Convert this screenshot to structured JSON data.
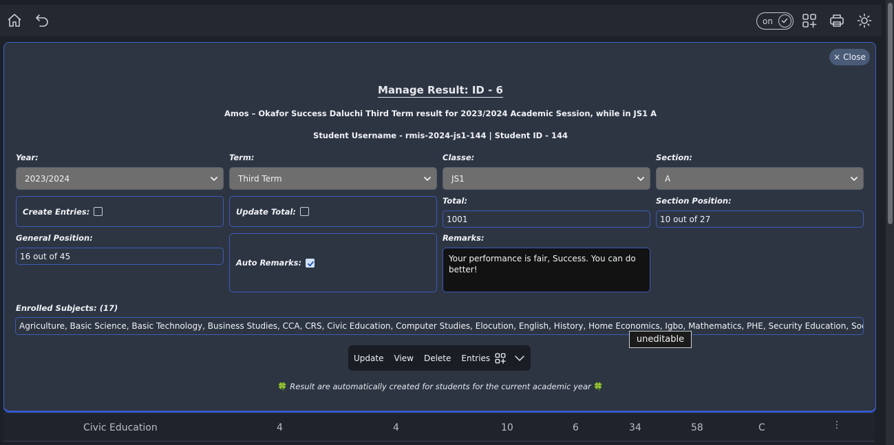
{
  "topbar": {
    "icons": [
      "home-icon",
      "undo-icon",
      "grid-add-icon",
      "printer-icon",
      "sun-icon"
    ],
    "toggle_label": "on"
  },
  "modal": {
    "close_label": "Close",
    "title": "Manage Result: ID - 6",
    "subtitle": "Amos – Okafor Success Daluchi Third Term result for 2023/2024 Academic Session, while in JS1 A",
    "student_info": "Student Username - rmis-2024-js1-144 | Student ID - 144",
    "year": {
      "label": "Year:",
      "value": "2023/2024"
    },
    "term": {
      "label": "Term:",
      "value": "Third Term"
    },
    "classe": {
      "label": "Classe:",
      "value": "JS1"
    },
    "section": {
      "label": "Section:",
      "value": "A"
    },
    "create_entries": {
      "label": "Create Entries:",
      "checked": false
    },
    "update_total": {
      "label": "Update Total:",
      "checked": false
    },
    "total": {
      "label": "Total:",
      "value": "1001"
    },
    "section_position": {
      "label": "Section Position:",
      "value": "10 out of 27"
    },
    "general_position": {
      "label": "General Position:",
      "value": "16 out of 45"
    },
    "auto_remarks": {
      "label": "Auto Remarks:",
      "checked": true
    },
    "remarks": {
      "label": "Remarks:",
      "value": "Your performance is fair, Success. You can do better!"
    },
    "enrolled": {
      "label": "Enrolled Subjects: (17)",
      "value": "Agriculture, Basic Science, Basic Technology, Business Studies, CCA, CRS, Civic Education, Computer Studies, Elocution, English, History, Home Economics, Igbo, Mathematics, PHE, Security Education, Social Studies"
    },
    "tooltip": "uneditable",
    "actions": {
      "update": "Update",
      "view": "View",
      "delete": "Delete",
      "entries": "Entries"
    },
    "note": "Result are automatically created for students for the current academic year",
    "note_emoji": "🍀"
  },
  "table_row": {
    "subject": "Civic Education",
    "values": [
      "4",
      "4",
      "10",
      "6",
      "34",
      "58",
      "C"
    ]
  }
}
